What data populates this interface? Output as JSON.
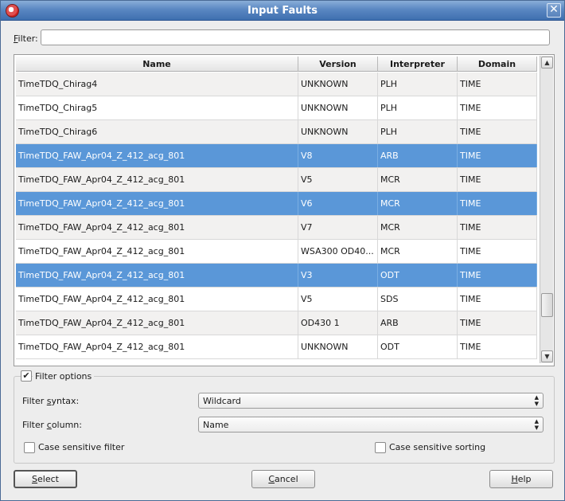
{
  "window": {
    "title": "Input Faults"
  },
  "filter": {
    "label_prefix": "",
    "label_mnemonic": "F",
    "label_rest": "ilter:",
    "value": ""
  },
  "table": {
    "columns": [
      "Name",
      "Version",
      "Interpreter",
      "Domain"
    ],
    "rows": [
      {
        "name": "TimeTDQ_Chirag4",
        "version": "UNKNOWN",
        "interpreter": "PLH",
        "domain": "TIME",
        "selected": false
      },
      {
        "name": "TimeTDQ_Chirag5",
        "version": "UNKNOWN",
        "interpreter": "PLH",
        "domain": "TIME",
        "selected": false
      },
      {
        "name": "TimeTDQ_Chirag6",
        "version": "UNKNOWN",
        "interpreter": "PLH",
        "domain": "TIME",
        "selected": false
      },
      {
        "name": "TimeTDQ_FAW_Apr04_Z_412_acg_801",
        "version": "V8",
        "interpreter": "ARB",
        "domain": "TIME",
        "selected": true
      },
      {
        "name": "TimeTDQ_FAW_Apr04_Z_412_acg_801",
        "version": "V5",
        "interpreter": "MCR",
        "domain": "TIME",
        "selected": false
      },
      {
        "name": "TimeTDQ_FAW_Apr04_Z_412_acg_801",
        "version": "V6",
        "interpreter": "MCR",
        "domain": "TIME",
        "selected": true
      },
      {
        "name": "TimeTDQ_FAW_Apr04_Z_412_acg_801",
        "version": "V7",
        "interpreter": "MCR",
        "domain": "TIME",
        "selected": false
      },
      {
        "name": "TimeTDQ_FAW_Apr04_Z_412_acg_801",
        "version": "WSA300 OD40...",
        "interpreter": "MCR",
        "domain": "TIME",
        "selected": false
      },
      {
        "name": "TimeTDQ_FAW_Apr04_Z_412_acg_801",
        "version": "V3",
        "interpreter": "ODT",
        "domain": "TIME",
        "selected": true
      },
      {
        "name": "TimeTDQ_FAW_Apr04_Z_412_acg_801",
        "version": "V5",
        "interpreter": "SDS",
        "domain": "TIME",
        "selected": false
      },
      {
        "name": "TimeTDQ_FAW_Apr04_Z_412_acg_801",
        "version": "OD430 1",
        "interpreter": "ARB",
        "domain": "TIME",
        "selected": false
      },
      {
        "name": "TimeTDQ_FAW_Apr04_Z_412_acg_801",
        "version": "UNKNOWN",
        "interpreter": "ODT",
        "domain": "TIME",
        "selected": false
      }
    ]
  },
  "options": {
    "title": "Filter options",
    "checked": true,
    "syntax": {
      "label_prefix": "Filter ",
      "label_mnemonic": "s",
      "label_rest": "yntax:",
      "value": "Wildcard"
    },
    "column": {
      "label_prefix": "Filter ",
      "label_mnemonic": "c",
      "label_rest": "olumn:",
      "value": "Name"
    },
    "case_filter": {
      "label": "Case sensitive filter",
      "checked": false
    },
    "case_sort": {
      "label": "Case sensitive sorting",
      "checked": false
    }
  },
  "buttons": {
    "select": {
      "mnemonic": "S",
      "rest": "elect"
    },
    "cancel": {
      "mnemonic": "C",
      "rest": "ancel"
    },
    "help": {
      "mnemonic": "H",
      "rest": "elp"
    }
  },
  "icons": {
    "app": "app-icon",
    "close": "close-icon",
    "check": "check-icon",
    "up": "arrow-up-icon",
    "down": "arrow-down-icon"
  },
  "colors": {
    "selection": "#5a97d8",
    "titlebar": "#4d7ebd"
  }
}
